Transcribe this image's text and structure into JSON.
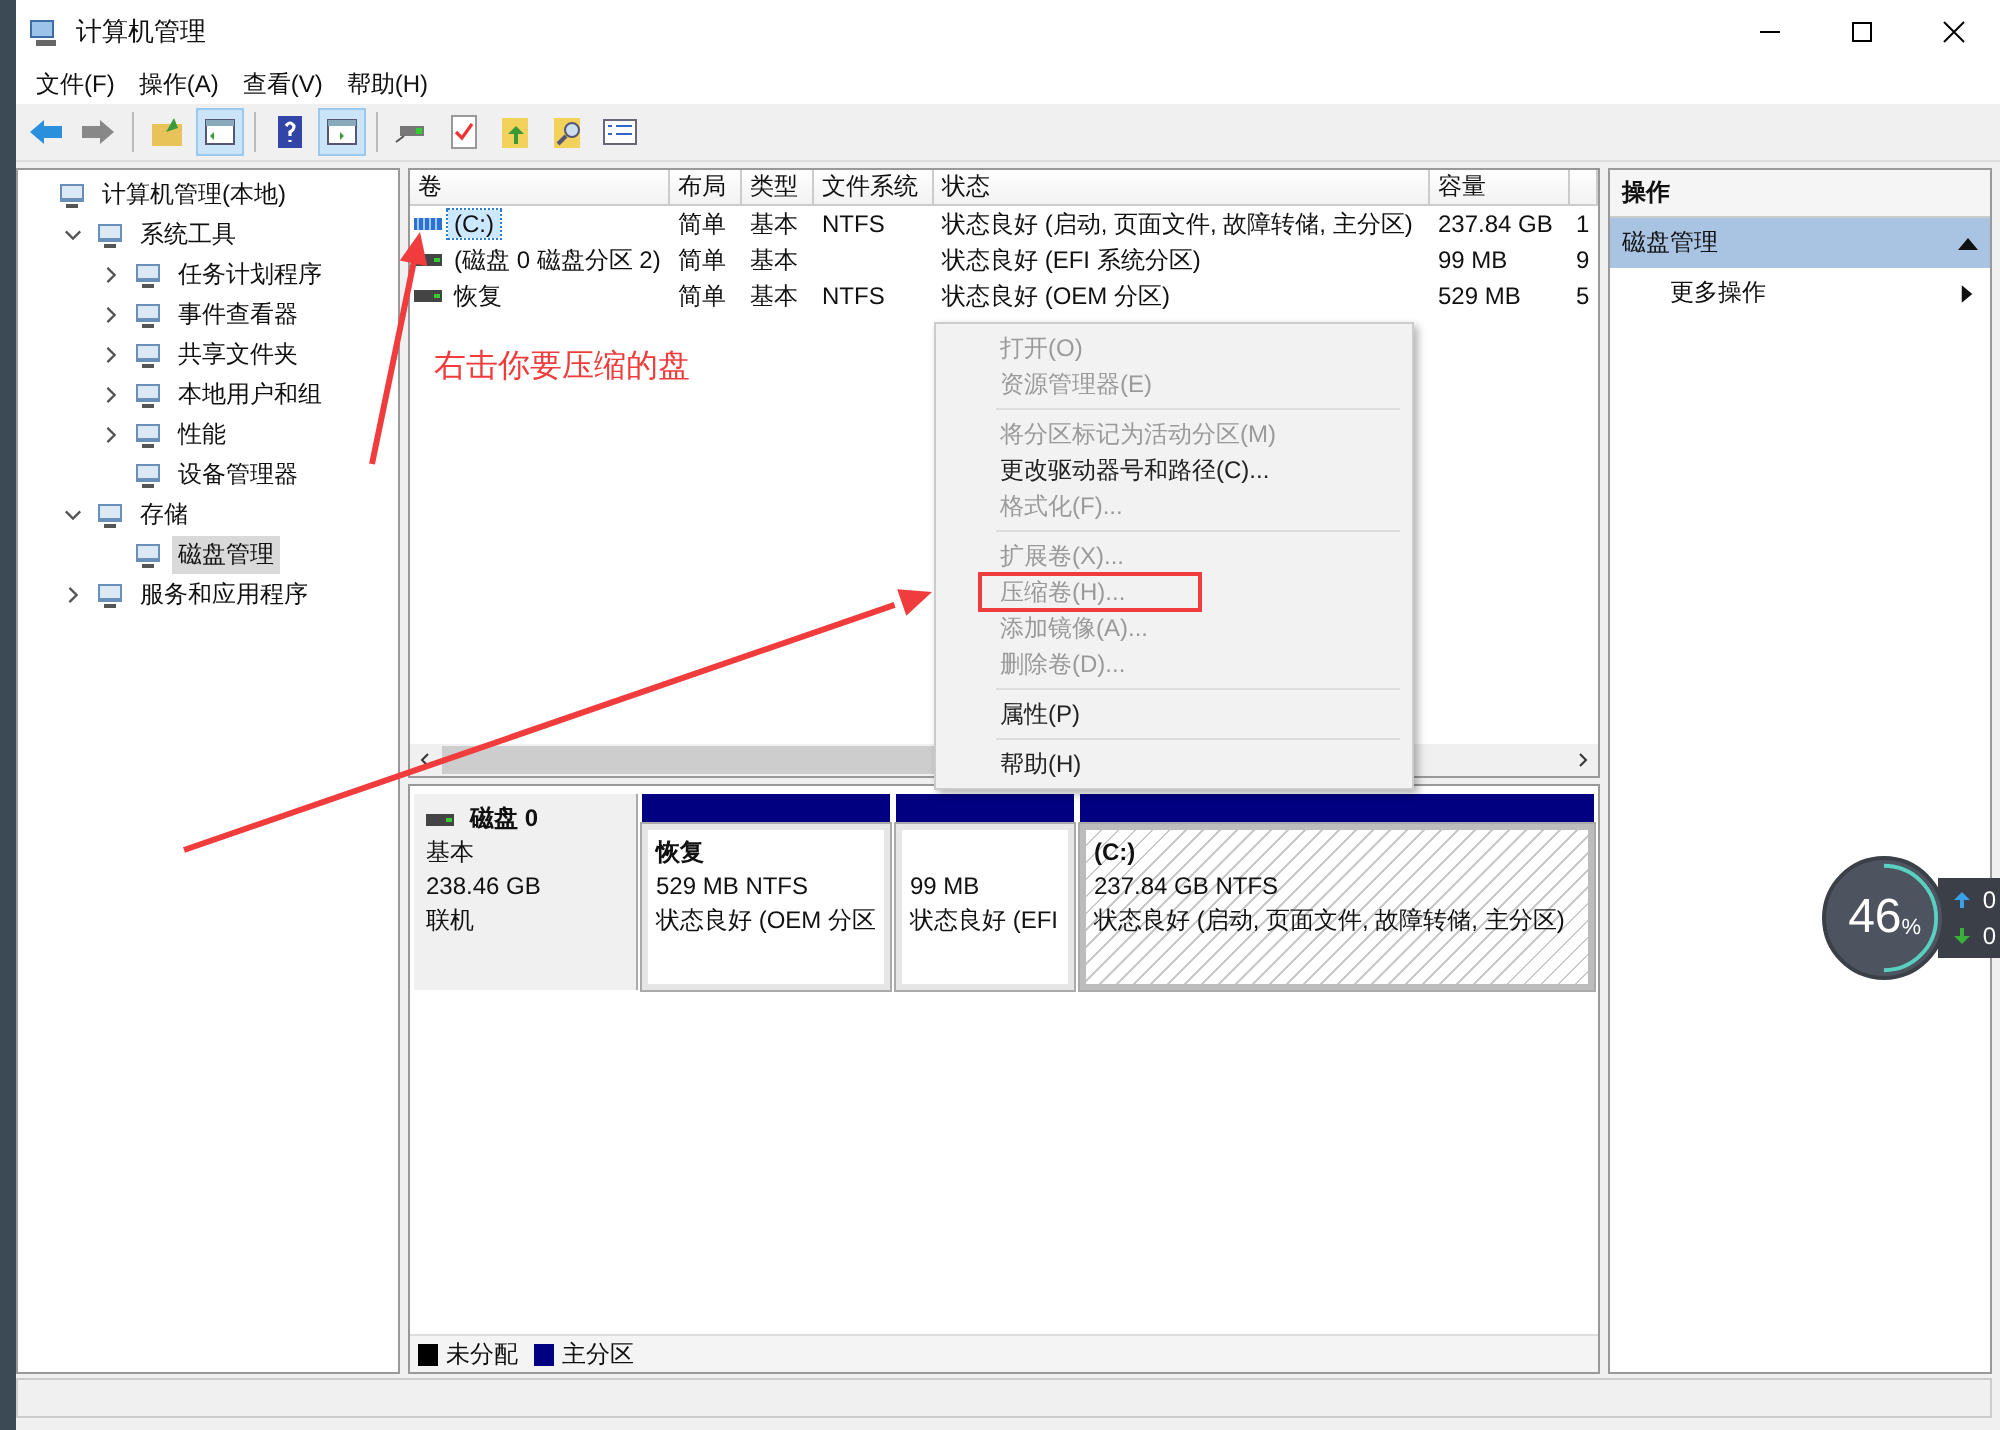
{
  "window": {
    "title": "计算机管理"
  },
  "menu": [
    "文件(F)",
    "操作(A)",
    "查看(V)",
    "帮助(H)"
  ],
  "tree": [
    {
      "label": "计算机管理(本地)",
      "selected": false,
      "children": [
        {
          "label": "系统工具",
          "selected": false,
          "expanded": true,
          "children": [
            {
              "label": "任务计划程序",
              "selected": false,
              "expanded": false
            },
            {
              "label": "事件查看器",
              "selected": false,
              "expanded": false
            },
            {
              "label": "共享文件夹",
              "selected": false,
              "expanded": false
            },
            {
              "label": "本地用户和组",
              "selected": false,
              "expanded": false
            },
            {
              "label": "性能",
              "selected": false,
              "expanded": false
            },
            {
              "label": "设备管理器",
              "selected": false
            }
          ]
        },
        {
          "label": "存储",
          "selected": false,
          "expanded": true,
          "children": [
            {
              "label": "磁盘管理",
              "selected": true
            }
          ]
        },
        {
          "label": "服务和应用程序",
          "selected": false,
          "expanded": false
        }
      ]
    }
  ],
  "table": {
    "columns": [
      "卷",
      "布局",
      "类型",
      "文件系统",
      "状态",
      "容量"
    ],
    "rows": [
      {
        "selected": true,
        "cells": [
          "(C:)",
          "简单",
          "基本",
          "NTFS",
          "状态良好 (启动, 页面文件, 故障转储, 主分区)",
          "237.84 GB",
          "1"
        ]
      },
      {
        "selected": false,
        "cells": [
          "(磁盘 0 磁盘分区 2)",
          "简单",
          "基本",
          "",
          "状态良好 (EFI 系统分区)",
          "99 MB",
          "9"
        ]
      },
      {
        "selected": false,
        "cells": [
          "恢复",
          "简单",
          "基本",
          "NTFS",
          "状态良好 (OEM 分区)",
          "529 MB",
          "5"
        ]
      }
    ]
  },
  "context_menu": [
    {
      "kind": "item",
      "label": "打开(O)",
      "disabled": true,
      "highlighted": false
    },
    {
      "kind": "item",
      "label": "资源管理器(E)",
      "disabled": true,
      "highlighted": false
    },
    {
      "kind": "separator"
    },
    {
      "kind": "item",
      "label": "将分区标记为活动分区(M)",
      "disabled": true,
      "highlighted": false
    },
    {
      "kind": "item",
      "label": "更改驱动器号和路径(C)...",
      "disabled": false,
      "highlighted": false
    },
    {
      "kind": "item",
      "label": "格式化(F)...",
      "disabled": true,
      "highlighted": false
    },
    {
      "kind": "separator"
    },
    {
      "kind": "item",
      "label": "扩展卷(X)...",
      "disabled": true,
      "highlighted": false
    },
    {
      "kind": "item",
      "label": "压缩卷(H)...",
      "disabled": true,
      "highlighted": true
    },
    {
      "kind": "item",
      "label": "添加镜像(A)...",
      "disabled": true,
      "highlighted": false
    },
    {
      "kind": "item",
      "label": "删除卷(D)...",
      "disabled": true,
      "highlighted": false
    },
    {
      "kind": "separator"
    },
    {
      "kind": "item",
      "label": "属性(P)",
      "disabled": false,
      "highlighted": false
    },
    {
      "kind": "separator"
    },
    {
      "kind": "item",
      "label": "帮助(H)",
      "disabled": false,
      "highlighted": false
    }
  ],
  "annotation": "右击你要压缩的盘",
  "disk": {
    "name": "磁盘 0",
    "type": "基本",
    "size": "238.46 GB",
    "status": "联机",
    "partitions": [
      {
        "title": "恢复",
        "size": "529 MB NTFS",
        "status": "状态良好 (OEM 分区",
        "selected": false
      },
      {
        "size": "99 MB",
        "status": "状态良好 (EFI",
        "selected": false
      },
      {
        "title": "(C:)",
        "size": "237.84 GB NTFS",
        "status": "状态良好 (启动, 页面文件, 故障转储, 主分区)",
        "selected": true
      }
    ]
  },
  "legend": [
    {
      "label": "未分配",
      "color": "#000000"
    },
    {
      "label": "主分区",
      "color": "#000080"
    }
  ],
  "actions": {
    "header": "操作",
    "section": {
      "label": "磁盘管理",
      "expanded": true
    },
    "items": [
      "更多操作"
    ]
  },
  "monitor": {
    "percent": "46",
    "unit": "%",
    "upload": "0",
    "download": "0"
  }
}
